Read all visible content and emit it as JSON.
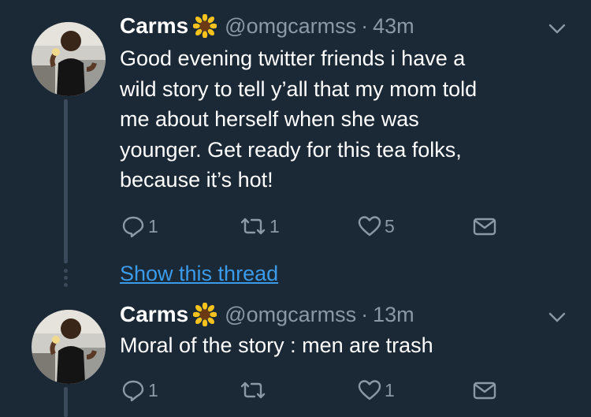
{
  "tweets": [
    {
      "name": "Carms",
      "handle": "@omgcarmss",
      "separator": "·",
      "time": "43m",
      "text": "Good evening twitter friends i have a\nwild story to tell y’all that my mom told\nme about herself when she was\nyounger. Get ready for this tea folks,\nbecause it’s hot!",
      "reply_count": "1",
      "retweet_count": "1",
      "like_count": "5"
    },
    {
      "name": "Carms",
      "handle": "@omgcarmss",
      "separator": "·",
      "time": "13m",
      "text": "Moral of the story : men are trash",
      "reply_count": "1",
      "retweet_count": "",
      "like_count": "1"
    }
  ],
  "show_thread_label": "Show this thread",
  "icons": {
    "badge": "sunflower-emoji-icon",
    "menu": "chevron-down-icon",
    "reply": "reply-icon",
    "retweet": "retweet-icon",
    "like": "heart-icon",
    "share": "envelope-icon"
  },
  "colors": {
    "background": "#1b2836",
    "secondary_text": "#8b98a6",
    "link": "#3a9bea",
    "thread_line": "#3b4a5a"
  }
}
